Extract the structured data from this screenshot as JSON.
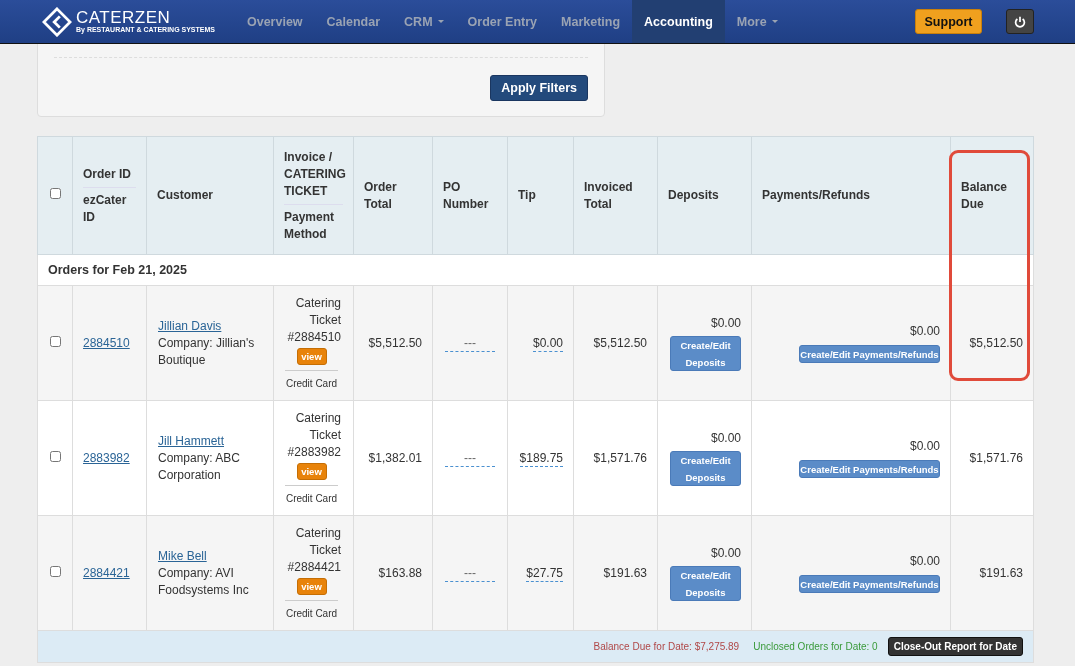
{
  "nav": {
    "logo": {
      "name": "CATERZEN",
      "tagline": "By RESTAURANT & CATERING SYSTEMS"
    },
    "items": [
      {
        "label": "Overview",
        "selected": false,
        "dropdown": false
      },
      {
        "label": "Calendar",
        "selected": false,
        "dropdown": false
      },
      {
        "label": "CRM",
        "selected": false,
        "dropdown": true
      },
      {
        "label": "Order Entry",
        "selected": false,
        "dropdown": false
      },
      {
        "label": "Marketing",
        "selected": false,
        "dropdown": false
      },
      {
        "label": "Accounting",
        "selected": true,
        "dropdown": false
      },
      {
        "label": "More",
        "selected": false,
        "dropdown": true
      }
    ],
    "support_button": "Support"
  },
  "filters": {
    "apply_button": "Apply Filters"
  },
  "table": {
    "columns": [
      {
        "lines": [
          "Order ID",
          "ezCater ID"
        ]
      },
      {
        "lines": [
          "Customer"
        ]
      },
      {
        "lines": [
          "Invoice / CATERING TICKET",
          "Payment Method"
        ]
      },
      {
        "lines": [
          "Order Total"
        ]
      },
      {
        "lines": [
          "PO Number"
        ]
      },
      {
        "lines": [
          "Tip"
        ]
      },
      {
        "lines": [
          "Invoiced Total"
        ]
      },
      {
        "lines": [
          "Deposits"
        ]
      },
      {
        "lines": [
          "Payments/Refunds"
        ]
      },
      {
        "lines": [
          "Balance Due"
        ],
        "highlighted": true
      }
    ],
    "select_all_checked": false,
    "group": "Orders for Feb 21, 2025",
    "rows": [
      {
        "checked": false,
        "order_id": "2884510",
        "customer": "Jillian Davis",
        "company": "Company: Jillian's Boutique",
        "ticket": "Catering Ticket #2884510",
        "view": "view",
        "payment_method": "Credit Card",
        "order_total": "$5,512.50",
        "po_number": "---",
        "tip": "$0.00",
        "invoiced_total": "$5,512.50",
        "deposits": "$0.00",
        "deposits_button": "Create/Edit Deposits",
        "payments": "$0.00",
        "payments_button": "Create/Edit Payments/Refunds",
        "balance_due": "$5,512.50"
      },
      {
        "checked": false,
        "order_id": "2883982",
        "customer": "Jill Hammett",
        "company": "Company: ABC Corporation",
        "ticket": "Catering Ticket #2883982",
        "view": "view",
        "payment_method": "Credit Card",
        "order_total": "$1,382.01",
        "po_number": "---",
        "tip": "$189.75",
        "invoiced_total": "$1,571.76",
        "deposits": "$0.00",
        "deposits_button": "Create/Edit Deposits",
        "payments": "$0.00",
        "payments_button": "Create/Edit Payments/Refunds",
        "balance_due": "$1,571.76"
      },
      {
        "checked": false,
        "order_id": "2884421",
        "customer": "Mike Bell",
        "company": "Company: AVI Foodsystems Inc",
        "ticket": "Catering Ticket #2884421",
        "view": "view",
        "payment_method": "Credit Card",
        "order_total": "$163.88",
        "po_number": "---",
        "tip": "$27.75",
        "invoiced_total": "$191.63",
        "deposits": "$0.00",
        "deposits_button": "Create/Edit Deposits",
        "payments": "$0.00",
        "payments_button": "Create/Edit Payments/Refunds",
        "balance_due": "$191.63"
      }
    ],
    "footer": {
      "balance": "Balance Due for Date: $7,275.89",
      "unclosed": "Unclosed Orders for Date: 0",
      "report_button": "Close-Out Report for Date"
    }
  }
}
